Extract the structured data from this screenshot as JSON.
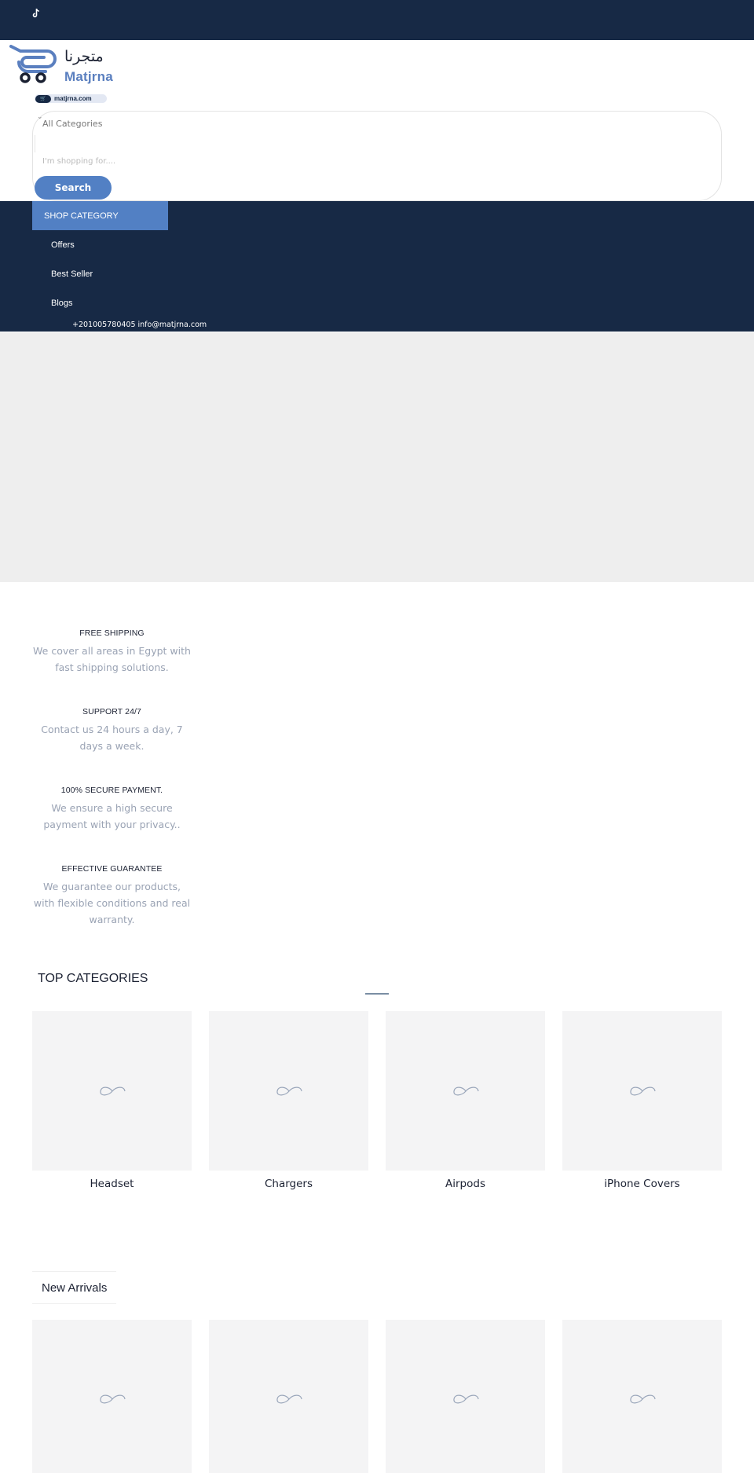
{
  "colors": {
    "navy": "#172945",
    "accent": "#5280c4",
    "muted_text": "#9aa3b4",
    "placeholder_bg": "#f4f4f5",
    "hero_bg": "#eeeeee"
  },
  "topbar": {
    "social_icons": [
      "tiktok-icon"
    ]
  },
  "logo": {
    "arabic": "متجرنا",
    "latin": "Matjrna",
    "domain": "matjrna.com"
  },
  "search": {
    "category_selected": "All Categories",
    "input_value": "",
    "placeholder": "I'm shopping for....",
    "button_label": "Search"
  },
  "nav": {
    "shop_category_label": "SHOP CATEGORY",
    "items": [
      {
        "label": "Offers"
      },
      {
        "label": "Best Seller"
      },
      {
        "label": "Blogs"
      }
    ],
    "contact": "+201005780405 info@matjrna.com"
  },
  "features": [
    {
      "title": "FREE SHIPPING",
      "description": "We cover all areas in Egypt with fast shipping solutions."
    },
    {
      "title": "SUPPORT 24/7",
      "description": "Contact us 24 hours a day, 7 days a week."
    },
    {
      "title": "100% SECURE PAYMENT.",
      "description": "We ensure a high secure payment with your privacy.."
    },
    {
      "title": "EFFECTIVE GUARANTEE",
      "description": "We guarantee our products, with flexible conditions and real warranty."
    }
  ],
  "top_categories": {
    "title": "TOP CATEGORIES",
    "items": [
      {
        "name": "Headset"
      },
      {
        "name": "Chargers"
      },
      {
        "name": "Airpods"
      },
      {
        "name": "iPhone Covers"
      }
    ]
  },
  "new_arrivals": {
    "tab_label": "New Arrivals",
    "product_count_visible": 4
  }
}
